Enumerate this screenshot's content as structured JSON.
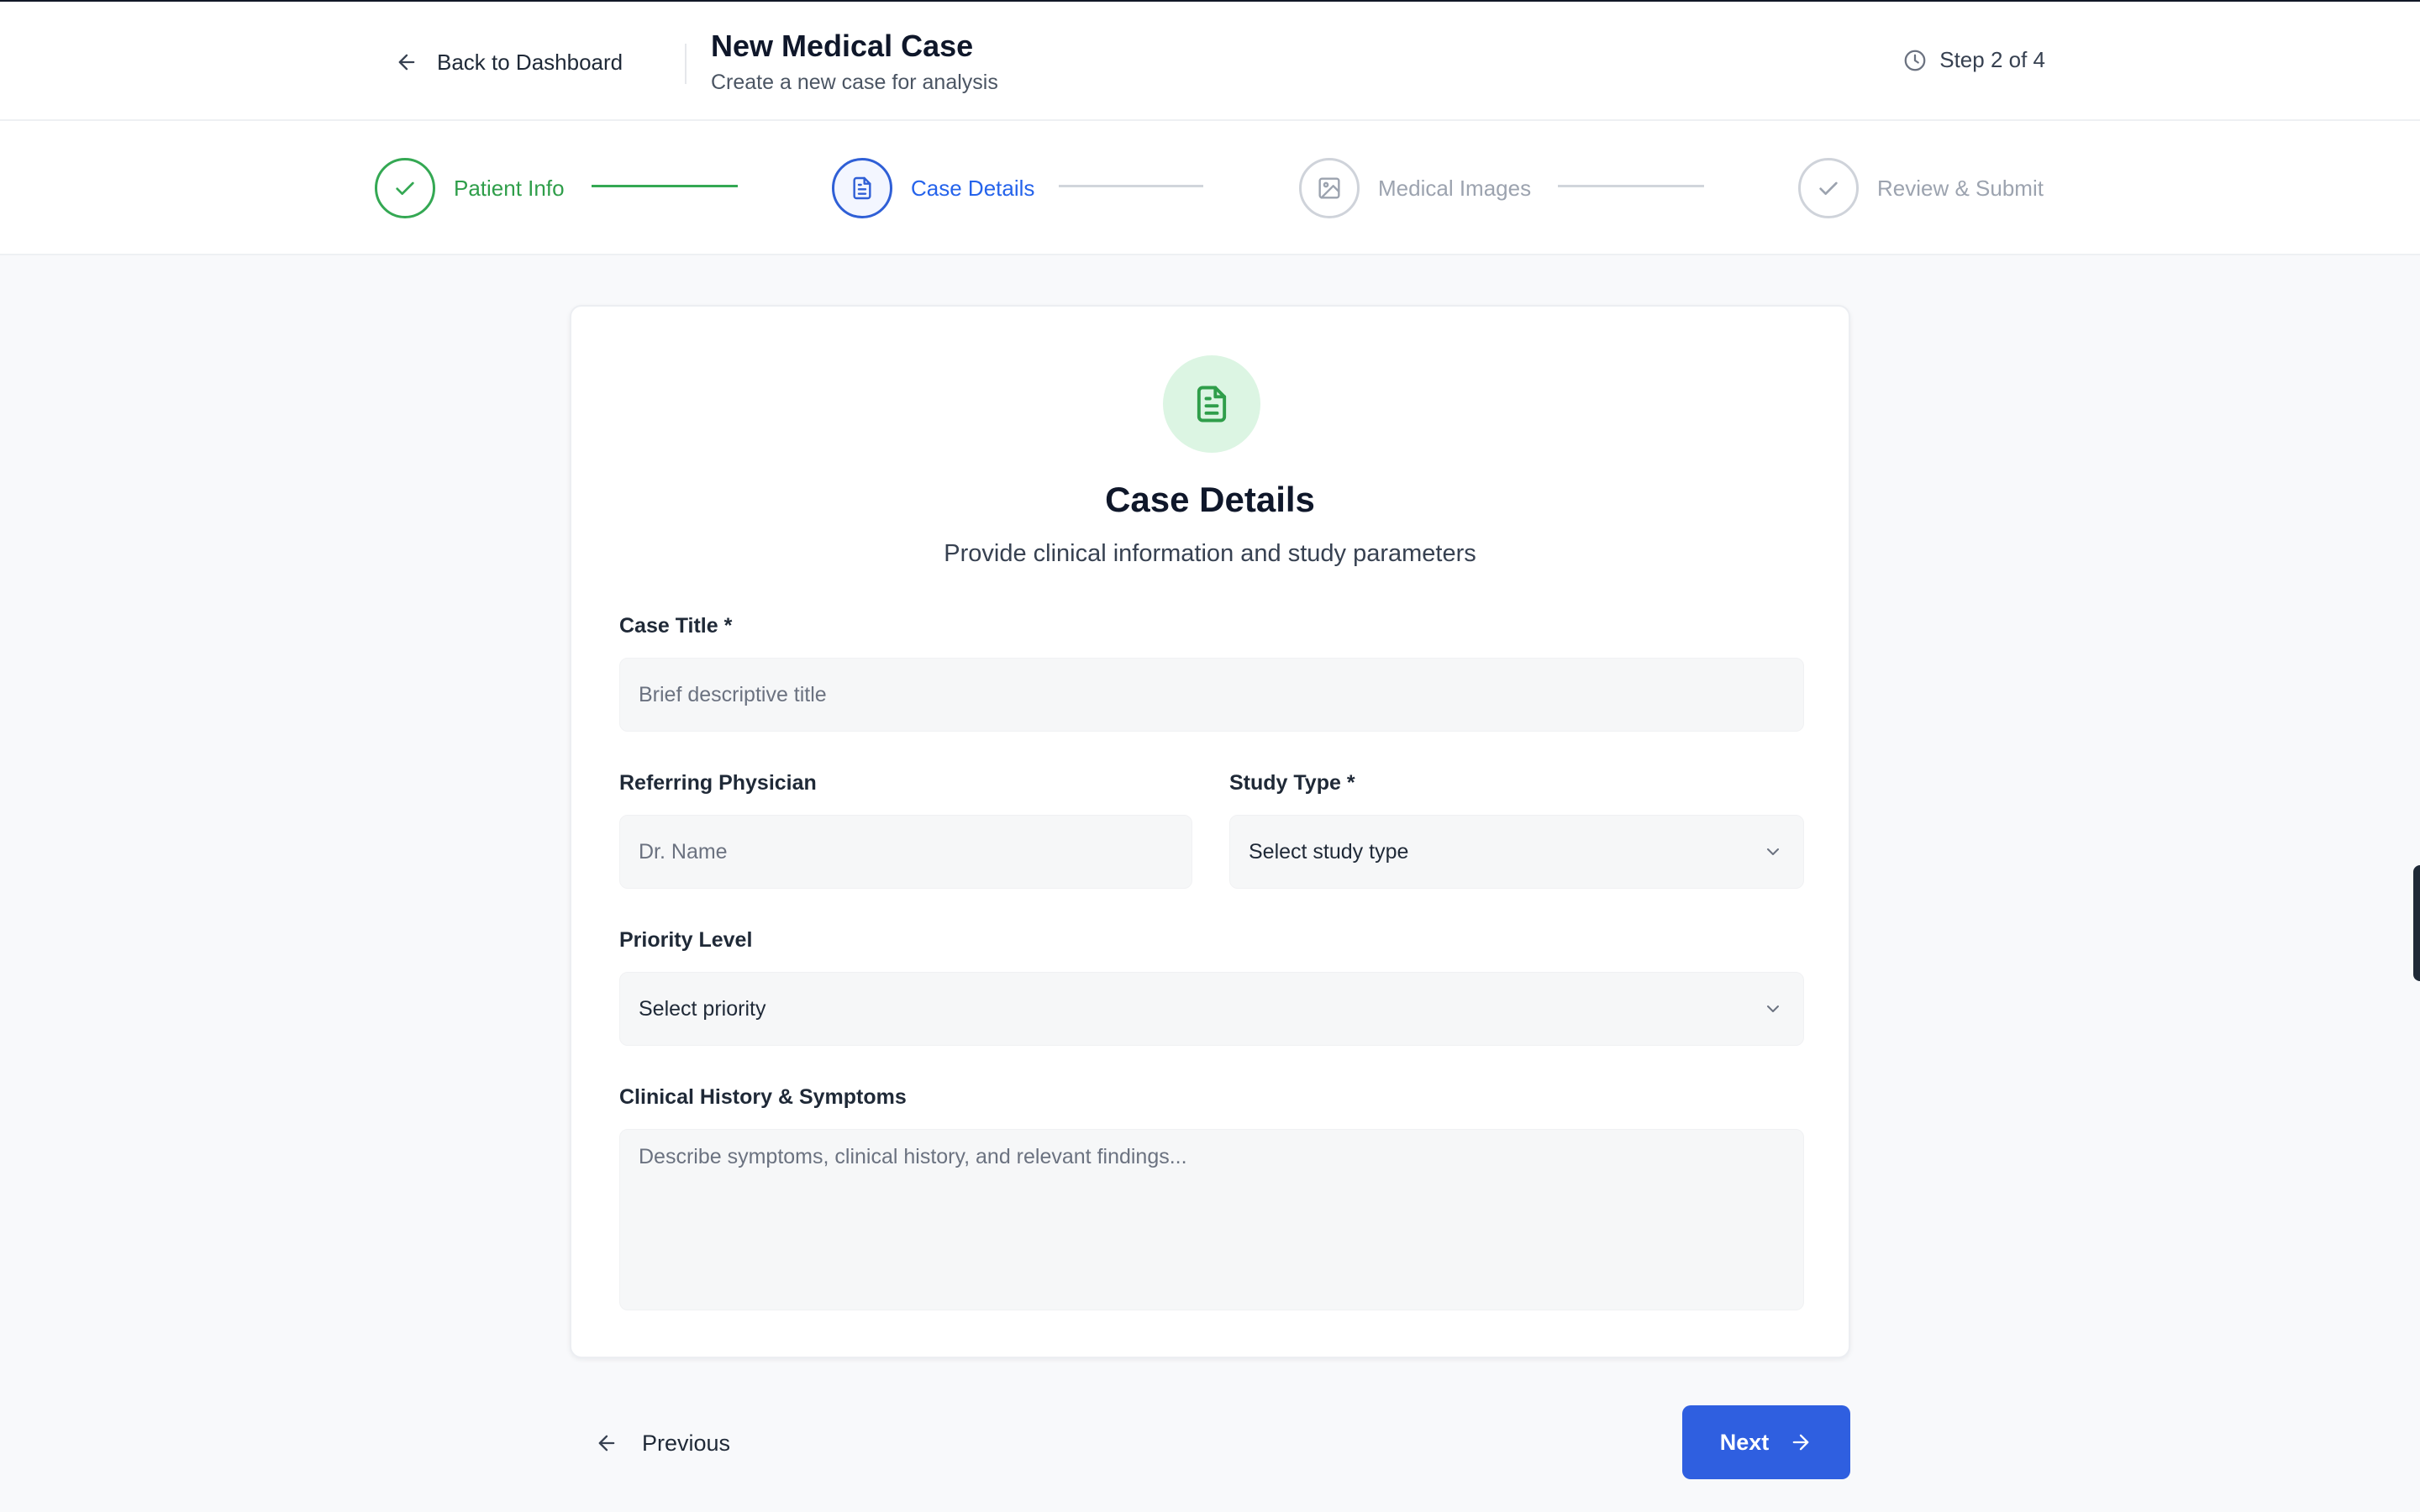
{
  "header": {
    "back_label": "Back to Dashboard",
    "title": "New Medical Case",
    "subtitle": "Create a new case for analysis",
    "step_indicator": "Step 2 of 4"
  },
  "stepper": {
    "steps": [
      {
        "label": "Patient Info",
        "state": "completed",
        "icon": "check-icon"
      },
      {
        "label": "Case Details",
        "state": "active",
        "icon": "document-icon"
      },
      {
        "label": "Medical Images",
        "state": "pending",
        "icon": "image-icon"
      },
      {
        "label": "Review & Submit",
        "state": "pending",
        "icon": "check-icon"
      }
    ]
  },
  "card": {
    "icon": "document-icon",
    "title": "Case Details",
    "subtitle": "Provide clinical information and study parameters",
    "fields": {
      "case_title": {
        "label": "Case Title *",
        "placeholder": "Brief descriptive title",
        "value": ""
      },
      "referring_physician": {
        "label": "Referring Physician",
        "placeholder": "Dr. Name",
        "value": ""
      },
      "study_type": {
        "label": "Study Type *",
        "selected": "Select study type"
      },
      "priority_level": {
        "label": "Priority Level",
        "selected": "Select priority"
      },
      "clinical_history": {
        "label": "Clinical History & Symptoms",
        "placeholder": "Describe symptoms, clinical history, and relevant findings...",
        "value": ""
      }
    }
  },
  "footer": {
    "previous_label": "Previous",
    "next_label": "Next"
  },
  "colors": {
    "accent_blue": "#2f5fe0",
    "active_step_blue": "#2563eb",
    "completed_green": "#34a853",
    "icon_bg_green": "#dcf5e3",
    "pending_gray": "#9ca3af"
  }
}
